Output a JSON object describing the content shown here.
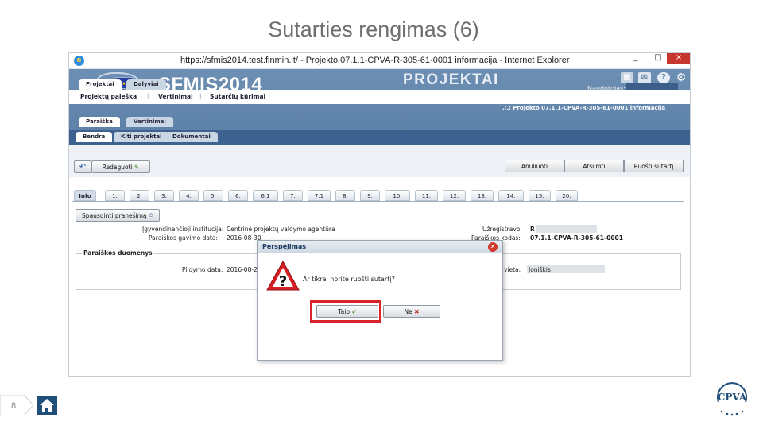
{
  "slide": {
    "title": "Sutarties rengimas (6)",
    "page_number": "8"
  },
  "browser": {
    "title": "https://sfmis2014.test.finmin.lt/ - Projekto 07.1.1-CPVA-R-305-61-0001 informacija - Internet Explorer",
    "minimize": "_",
    "maximize": "□",
    "close": "×"
  },
  "app": {
    "logo": "SFMIS2014",
    "section": "PROJEKTAI",
    "user_label": "Naudotojas:",
    "top_tabs": [
      "Projektai",
      "Dalyviai"
    ],
    "menu": [
      "Projektų paieška",
      "Vertinimai",
      "Sutarčių kūrimai"
    ],
    "menu_separator": "|",
    "breadcrumb": ".:.: Projekto 07.1.1-CPVA-R-305-61-0001 informacija",
    "second_tabs": [
      "Paraiška",
      "Vertinimai"
    ],
    "sub_tabs": [
      "Bendra",
      "Kiti projektai",
      "Dokumentai"
    ]
  },
  "toolbar": {
    "back_icon": "↶",
    "edit_label": "Redaguoti",
    "edit_icon": "✎",
    "cancel_label": "Anuliuoti",
    "reject_label": "Atsiimti",
    "prepare_label": "Ruošti sutartį"
  },
  "step_tabs": [
    "Info",
    "1.",
    "2.",
    "3.",
    "4.",
    "5.",
    "6.",
    "6.1",
    "7.",
    "7.1",
    "8.",
    "9.",
    "10.",
    "11.",
    "12.",
    "13.",
    "14.",
    "15.",
    "20."
  ],
  "form": {
    "print_label": "Spausdinti pranešimą",
    "institution_label": "Įgyvendinančioji institucija:",
    "institution_value": "Centrinė projektų valdymo agentūra",
    "received_date_label": "Paraiškos gavimo data:",
    "received_date_value": "2016-08-30",
    "registered_label": "Užregistravo:",
    "registered_value": "R",
    "code_label": "Paraiškos kodas:",
    "code_value": "07.1.1-CPVA-R-305-61-0001",
    "section_legend": "Paraiškos duomenys",
    "fill_date_label": "Pildymo data:",
    "fill_date_value": "2016-08-24",
    "place_label": "o vieta:",
    "place_value": "Joniškis"
  },
  "dialog": {
    "title": "Perspėjimas",
    "message": "Ar tikrai norite ruošti sutartį?",
    "yes_label": "Taip",
    "no_label": "Ne",
    "yes_icon": "✔",
    "no_icon": "✖"
  },
  "colors": {
    "header": "#5a7ea6",
    "highlight": "#d8232a",
    "title_gray": "#6e6e6e"
  },
  "footer": {
    "logo_text": "CPVA"
  }
}
